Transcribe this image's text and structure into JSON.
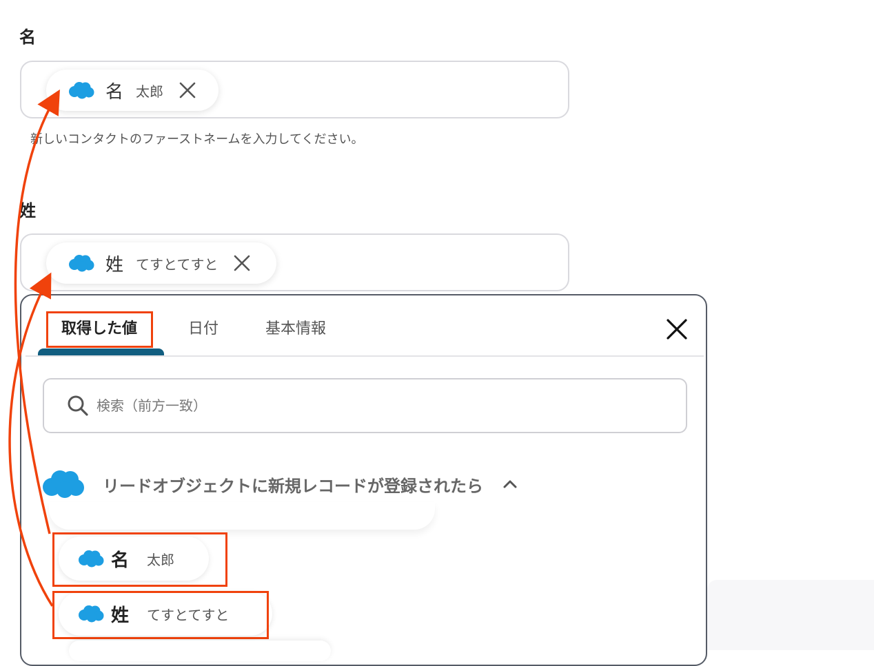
{
  "fields": {
    "first_name": {
      "label": "名",
      "chip_key": "名",
      "chip_value": "太郎",
      "help": "新しいコンタクトのファーストネームを入力してください。"
    },
    "last_name": {
      "label": "姓",
      "chip_key": "姓",
      "chip_value": "てすとてすと"
    }
  },
  "panel": {
    "tabs": [
      {
        "label": "取得した値",
        "active": true
      },
      {
        "label": "日付",
        "active": false
      },
      {
        "label": "基本情報",
        "active": false
      }
    ],
    "search": {
      "placeholder": "検索（前方一致）",
      "value": ""
    },
    "group": {
      "title": "リードオブジェクトに新規レコードが登録されたら",
      "expanded": true,
      "items": [
        {
          "key": "名",
          "value": "太郎"
        },
        {
          "key": "姓",
          "value": "てすとてすと"
        }
      ]
    }
  },
  "colors": {
    "salesforce_blue": "#1d9ee2",
    "highlight": "#f0420c",
    "tab_underline": "#115e80"
  },
  "icons": {
    "chip": "salesforce-cloud-icon",
    "remove": "close-icon",
    "search": "search-icon",
    "collapse": "chevron-up-icon",
    "panel_close": "close-icon"
  }
}
